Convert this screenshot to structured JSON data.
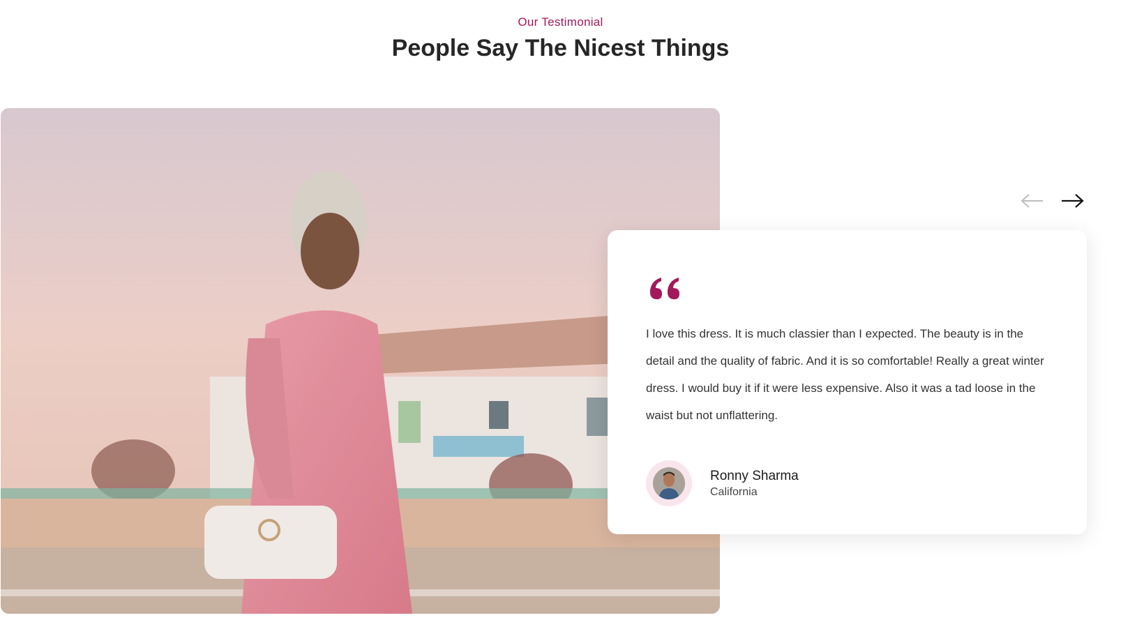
{
  "header": {
    "eyebrow": "Our Testimonial",
    "title": "People Say The Nicest Things"
  },
  "photo": {
    "subject": "woman-in-pink-dress-with-head-wrap"
  },
  "navigation": {
    "prev_icon": "arrow-left-icon",
    "next_icon": "arrow-right-icon",
    "prev_enabled": false,
    "next_enabled": true
  },
  "testimonial": {
    "quote_icon": "quote-icon",
    "text": "I love this dress. It is much classier than I expected. The beauty is in the detail and the quality of fabric. And it is so comfortable! Really a great winter dress. I would buy it if it were less expensive. Also it was a tad loose in the waist but not unflattering.",
    "author_name": "Ronny Sharma",
    "author_location": "California"
  },
  "colors": {
    "accent": "#a3195b",
    "heading": "#262626",
    "body_text": "#333333",
    "arrow_disabled": "#bdbdbd",
    "arrow_active": "#111111"
  }
}
